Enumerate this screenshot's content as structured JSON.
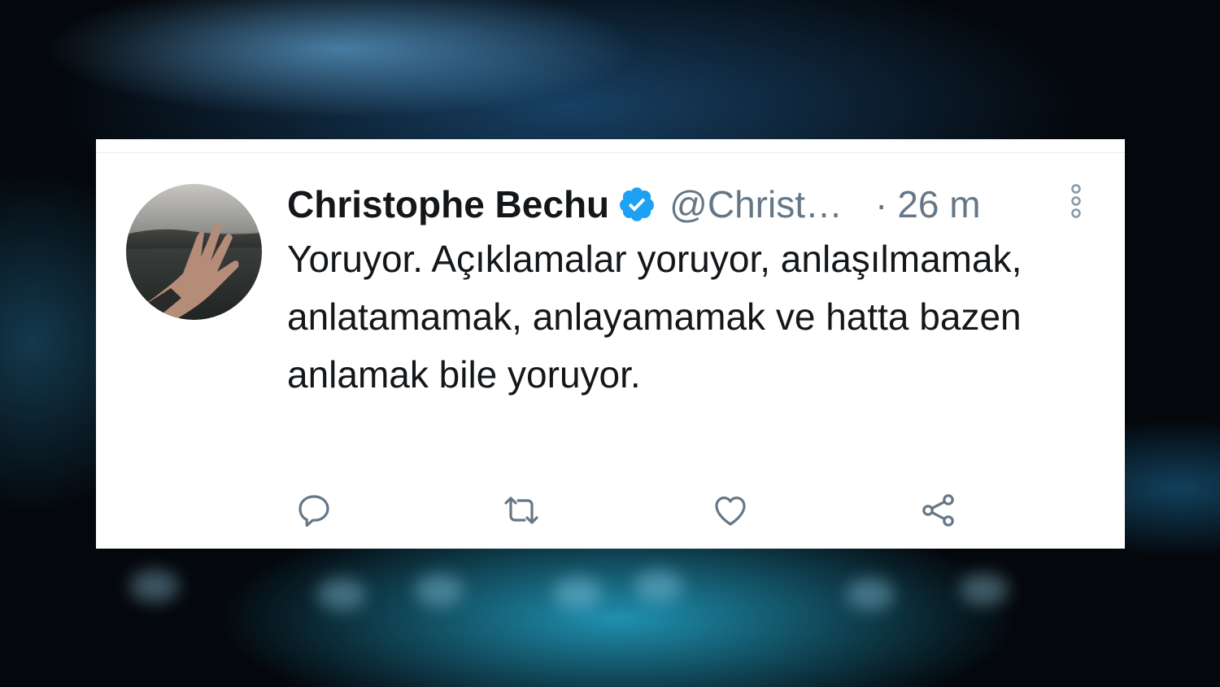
{
  "tweet": {
    "author_name": "Christophe Bechu",
    "handle": "@Christ…",
    "separator": "·",
    "time": "26 m",
    "verified": true,
    "text": "Yoruyor. Açıklamalar yoruyor, anlaşılmamak, anlatamamak, anlayamamak ve hatta bazen anlamak bile yoruyor."
  },
  "icons": {
    "verified": "verified-badge-icon",
    "more": "more-vertical-icon",
    "reply": "reply-icon",
    "retweet": "retweet-icon",
    "like": "heart-icon",
    "share": "share-icon"
  },
  "colors": {
    "verified_blue": "#1da1f2",
    "text": "#14171a",
    "secondary": "#657786",
    "card_bg": "#ffffff"
  }
}
